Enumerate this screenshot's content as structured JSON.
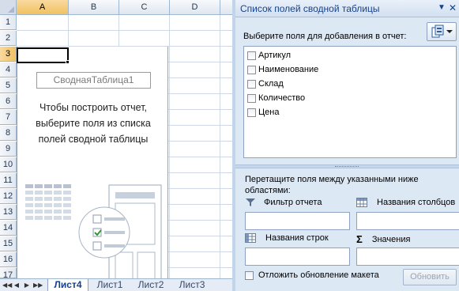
{
  "spreadsheet": {
    "columns": [
      "A",
      "B",
      "C",
      "D"
    ],
    "rows": [
      "1",
      "2",
      "3",
      "4",
      "5",
      "6",
      "7",
      "8",
      "9",
      "10",
      "11",
      "12",
      "13",
      "14",
      "15",
      "16",
      "17"
    ],
    "selected_column": "A",
    "selected_row": "3"
  },
  "pivot_placeholder": {
    "name": "СводнаяТаблица1",
    "hint": "Чтобы построить отчет, выберите поля из списка полей сводной таблицы"
  },
  "sheet_tabs": {
    "nav_buttons": [
      "◀◀",
      "◀",
      "▶",
      "▶▶"
    ],
    "tabs": [
      {
        "label": "Лист4",
        "active": true
      },
      {
        "label": "Лист1",
        "active": false
      },
      {
        "label": "Лист2",
        "active": false
      },
      {
        "label": "Лист3",
        "active": false
      }
    ]
  },
  "field_list_pane": {
    "title": "Список полей сводной таблицы",
    "choose_label": "Выберите поля для добавления в отчет:",
    "fields": [
      {
        "label": "Артикул",
        "checked": false
      },
      {
        "label": "Наименование",
        "checked": false
      },
      {
        "label": "Склад",
        "checked": false
      },
      {
        "label": "Количество",
        "checked": false
      },
      {
        "label": "Цена",
        "checked": false
      }
    ],
    "drag_hint": "Перетащите поля между указанными ниже областями:",
    "areas": {
      "report_filter": "Фильтр отчета",
      "column_labels": "Названия столбцов",
      "row_labels": "Названия строк",
      "values": "Значения"
    },
    "defer_update_label": "Отложить обновление макета",
    "refresh_button": "Обновить"
  },
  "colors": {
    "header_text": "#15428b",
    "pane_bg": "#dde8f5",
    "selected_header": "#f1c15f"
  },
  "icons": [
    "filter-icon",
    "column-grid-icon",
    "row-grid-icon",
    "sigma-icon",
    "field-layout-icon",
    "dropdown-arrow-icon",
    "close-icon"
  ]
}
